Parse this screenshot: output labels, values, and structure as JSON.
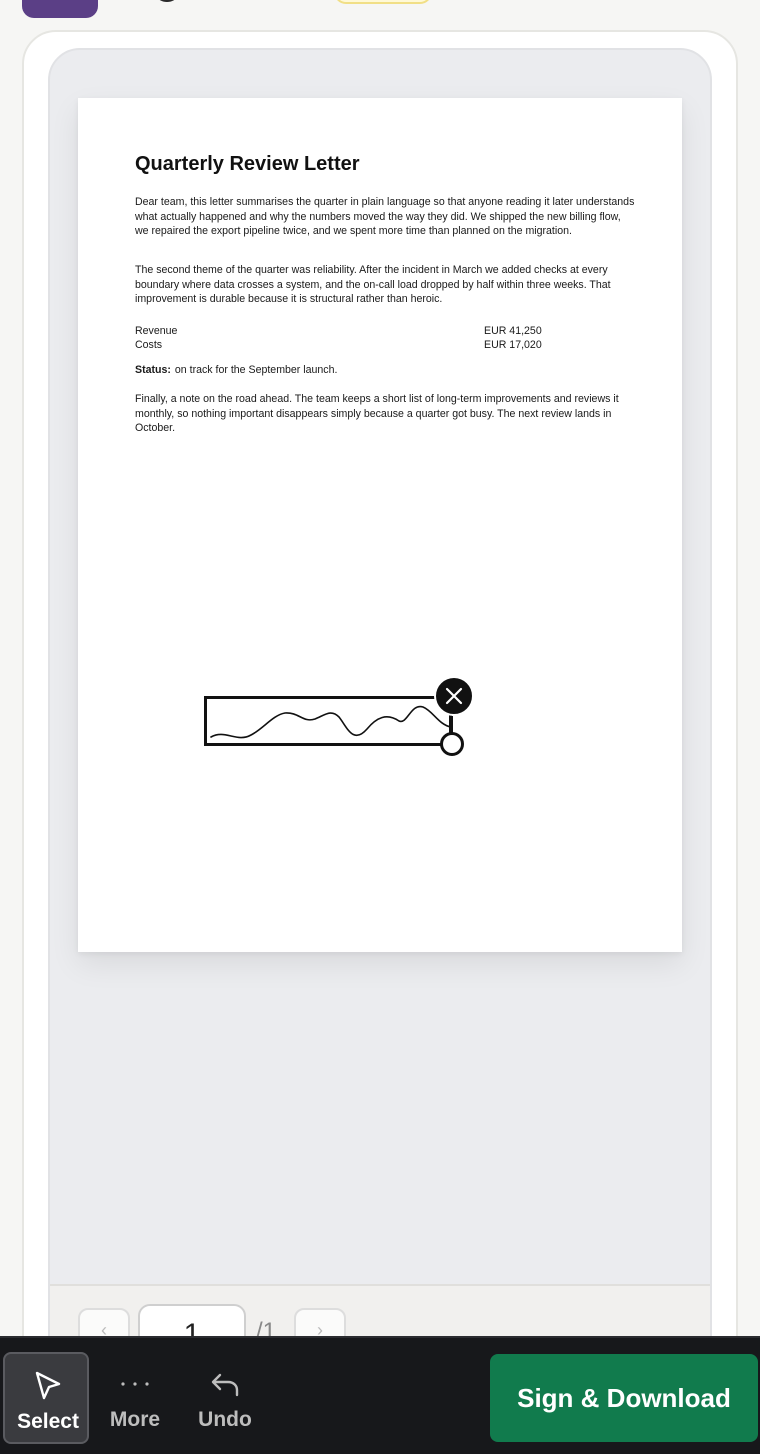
{
  "document": {
    "title": "Quarterly Review Letter",
    "paragraphs": [
      "Dear team, this letter summarises the quarter in plain language so that anyone reading it later understands what actually happened and why the numbers moved the way they did. We shipped the new billing flow, we repaired the export pipeline twice, and we spent more time than planned on the migration.",
      "The second theme of the quarter was reliability. After the incident in March we added checks at every boundary where data crosses a system, and the on-call load dropped by half within three weeks. That improvement is durable because it is structural rather than heroic.",
      "Finally, a note on the road ahead. The team keeps a short list of long-term improvements and reviews it monthly, so nothing important disappears simply because a quarter got busy. The next review lands in October."
    ],
    "financials": [
      {
        "label": "Revenue",
        "value": "EUR 41,250"
      },
      {
        "label": "Costs",
        "value": "EUR 17,020"
      }
    ],
    "status_label": "Status:",
    "status_text": "on track for the September launch."
  },
  "pager": {
    "current_page": "1",
    "total": "/1",
    "prev_icon": "chevron-left-icon",
    "next_icon": "chevron-right-icon"
  },
  "toolbar": {
    "select_label": "Select",
    "more_label": "More",
    "undo_label": "Undo",
    "sign_label": "Sign & Download"
  },
  "colors": {
    "primary": "#117b4d",
    "toolbar_bg": "#17181b",
    "avatar": "#5b3f86"
  }
}
